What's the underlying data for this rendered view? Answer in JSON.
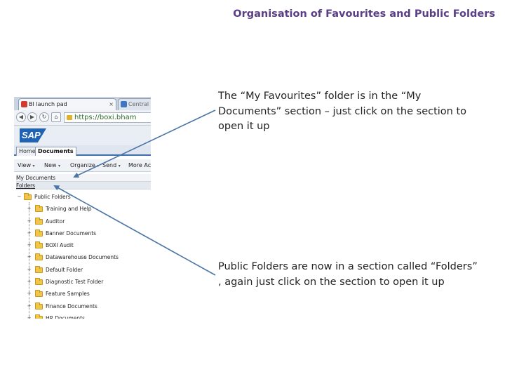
{
  "slide": {
    "title": "Organisation of Favourites and Public Folders",
    "caption_1": "The “My Favourites” folder is in the “My Documents” section – just click on the section to open it up",
    "caption_2": "Public Folders are now in a section called “Folders” , again just click on the section to open it up"
  },
  "colors": {
    "title": "#5b3f86",
    "arrow": "#4a75a6",
    "sap_blue": "#1f63b6",
    "folder": "#f0c64a"
  },
  "browser": {
    "tabs": [
      {
        "label": "BI launch pad",
        "icon": "sap-favicon",
        "close": "×"
      },
      {
        "label": "Central",
        "icon": "ie-favicon"
      }
    ],
    "url": "https://boxi.bham",
    "logo": "SAP"
  },
  "app": {
    "tabs": [
      "Home",
      "Documents"
    ],
    "toolbar": {
      "view": "View",
      "new": "New",
      "organize": "Organize",
      "send": "Send",
      "more": "More Act"
    },
    "sections": {
      "my_documents": "My Documents",
      "folders": "Folders"
    },
    "tree": {
      "root": "Public Folders",
      "children": [
        "Training and Help",
        "Auditor",
        "Banner Documents",
        "BOXI Audit",
        "Datawarehouse Documents",
        "Default Folder",
        "Diagnostic Test Folder",
        "Feature Samples",
        "Finance Documents",
        "HR Documents"
      ]
    }
  }
}
